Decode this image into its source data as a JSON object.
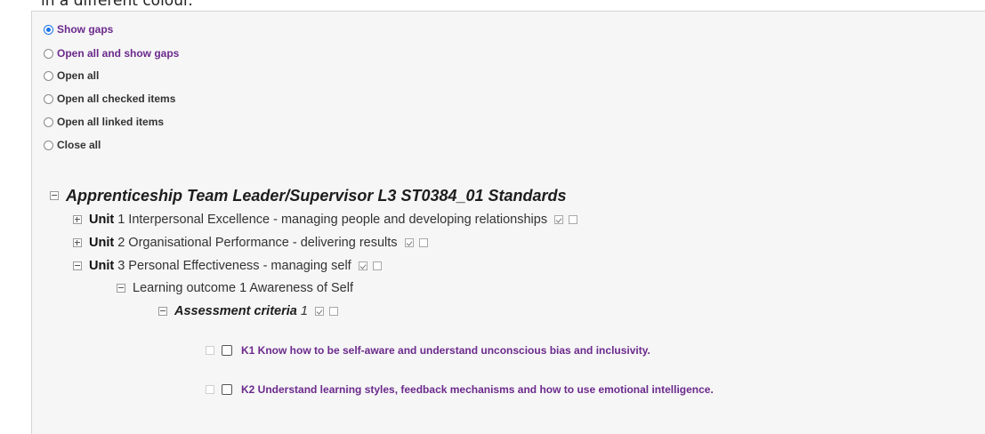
{
  "caption": "in a different colour.",
  "view_options": [
    {
      "label": "Show gaps",
      "selected": true,
      "color": "#6b2a8c"
    },
    {
      "label": "Open all and show gaps",
      "selected": false,
      "color": "#6b2a8c"
    },
    {
      "label": "Open all",
      "selected": false,
      "color": "#333333"
    },
    {
      "label": "Open all checked items",
      "selected": false,
      "color": "#333333"
    },
    {
      "label": "Open all linked items",
      "selected": false,
      "color": "#333333"
    },
    {
      "label": "Close all",
      "selected": false,
      "color": "#333333"
    }
  ],
  "tree": {
    "standard_title": "Apprenticeship Team Leader/Supervisor L3 ST0384_01 Standards",
    "units": [
      {
        "keyword": "Unit",
        "text": " 1 Interpersonal Excellence - managing people and developing relationships",
        "expanded": false
      },
      {
        "keyword": "Unit",
        "text": " 2 Organisational Performance - delivering results",
        "expanded": false
      },
      {
        "keyword": "Unit",
        "text": " 3 Personal Effectiveness - managing self",
        "expanded": true
      }
    ],
    "learning_outcome": "Learning outcome 1 Awareness of Self",
    "assessment_criteria": {
      "label": "Assessment criteria",
      "number": "1"
    },
    "criteria_items": [
      {
        "text": "K1 Know how to be self-aware and understand unconscious bias and inclusivity."
      },
      {
        "text": "K2 Understand learning styles, feedback mechanisms and how to use emotional intelligence."
      }
    ]
  },
  "colors": {
    "accent_purple": "#6b2a8c",
    "radio_selected": "#1a73e8",
    "panel_bg": "#f6f6f6"
  }
}
